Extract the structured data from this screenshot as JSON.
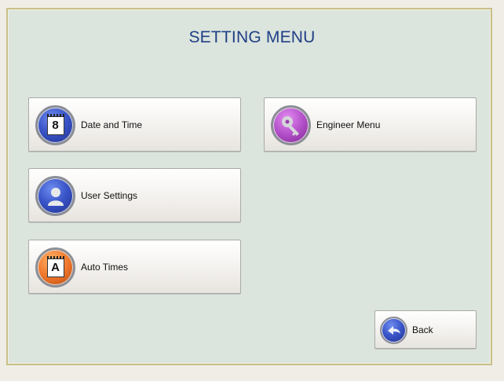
{
  "title": "SETTING MENU",
  "buttons": {
    "date_time": {
      "label": "Date and Time",
      "icon": "calendar-icon",
      "icon_text": "8"
    },
    "user_settings": {
      "label": "User Settings",
      "icon": "user-icon"
    },
    "auto_times": {
      "label": "Auto Times",
      "icon": "calendar-a-icon",
      "icon_text": "A"
    },
    "engineer_menu": {
      "label": "Engineer Menu",
      "icon": "key-icon"
    },
    "back": {
      "label": "Back",
      "icon": "back-arrow-icon"
    }
  },
  "colors": {
    "title": "#1f3f86",
    "background": "#d8e2dc",
    "frame_border": "#c8c088",
    "blue_icon": "#3a55c9",
    "orange_icon": "#f0772b",
    "purple_icon": "#b24fc9"
  }
}
